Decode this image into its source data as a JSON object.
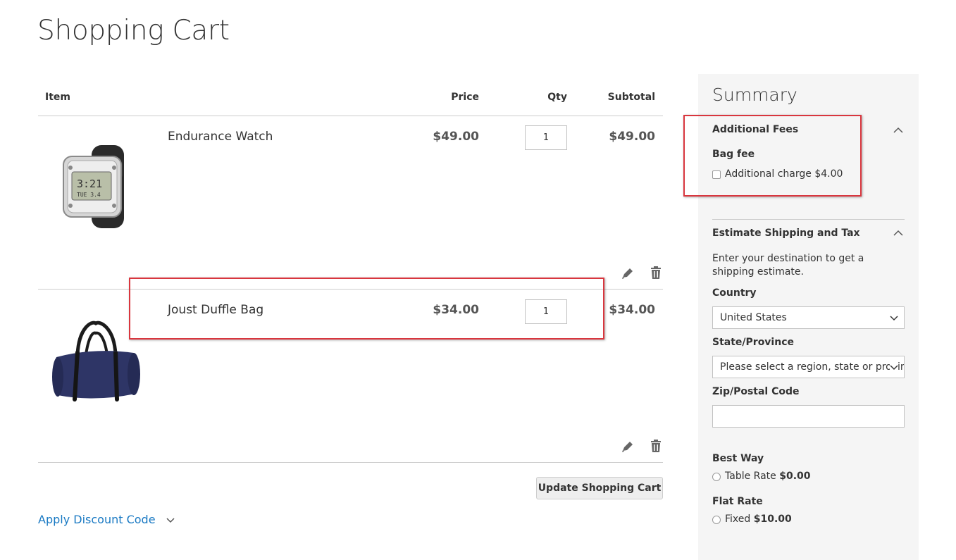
{
  "page": {
    "title": "Shopping Cart"
  },
  "table": {
    "headers": {
      "item": "Item",
      "price": "Price",
      "qty": "Qty",
      "subtotal": "Subtotal"
    },
    "items": [
      {
        "name": "Endurance Watch",
        "price": "$49.00",
        "qty": "1",
        "subtotal": "$49.00",
        "image_icon": "watch-image"
      },
      {
        "name": "Joust Duffle Bag",
        "price": "$34.00",
        "qty": "1",
        "subtotal": "$34.00",
        "image_icon": "duffle-bag-image"
      }
    ]
  },
  "actions": {
    "update_label": "Update Shopping Cart",
    "discount_label": "Apply Discount Code"
  },
  "summary": {
    "title": "Summary",
    "additional_fees": {
      "title": "Additional Fees",
      "group_label": "Bag fee",
      "option_label": "Additional charge $4.00",
      "checked": false
    },
    "shipping": {
      "title": "Estimate Shipping and Tax",
      "description": "Enter your destination to get a shipping estimate.",
      "country_label": "Country",
      "country_value": "United States",
      "state_label": "State/Province",
      "state_value": "Please select a region, state or province.",
      "zip_label": "Zip/Postal Code",
      "zip_value": "",
      "methods": [
        {
          "carrier": "Best Way",
          "method": "Table Rate",
          "price": "$0.00"
        },
        {
          "carrier": "Flat Rate",
          "method": "Fixed",
          "price": "$10.00"
        }
      ]
    }
  },
  "colors": {
    "link": "#1979c3",
    "highlight": "#d9363e",
    "summary_bg": "#f5f5f5"
  }
}
